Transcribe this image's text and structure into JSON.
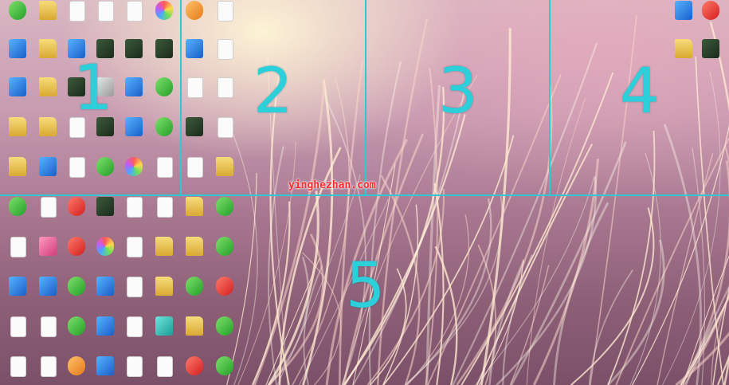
{
  "watermark": "yinghezhan.com",
  "zones": [
    {
      "label": "1"
    },
    {
      "label": "2"
    },
    {
      "label": "3"
    },
    {
      "label": "4"
    },
    {
      "label": "5"
    }
  ],
  "icons": [
    {
      "label": "",
      "kind": "app-green"
    },
    {
      "label": "",
      "kind": "folder"
    },
    {
      "label": "",
      "kind": "doc"
    },
    {
      "label": "",
      "kind": "doc"
    },
    {
      "label": "",
      "kind": "doc"
    },
    {
      "label": "",
      "kind": "app-multi"
    },
    {
      "label": "",
      "kind": "app-orange"
    },
    {
      "label": "",
      "kind": "doc"
    },
    {
      "label": "",
      "kind": "app-blue"
    },
    {
      "label": "",
      "kind": "folder"
    },
    {
      "label": "",
      "kind": "app-blue"
    },
    {
      "label": "",
      "kind": "app-dark"
    },
    {
      "label": "",
      "kind": "app-dark"
    },
    {
      "label": "",
      "kind": "app-dark"
    },
    {
      "label": "",
      "kind": "app-blue"
    },
    {
      "label": "",
      "kind": "doc"
    },
    {
      "label": "",
      "kind": "app-blue"
    },
    {
      "label": "",
      "kind": "folder"
    },
    {
      "label": "",
      "kind": "app-dark"
    },
    {
      "label": "",
      "kind": "app-gray"
    },
    {
      "label": "",
      "kind": "app-blue"
    },
    {
      "label": "",
      "kind": "app-green"
    },
    {
      "label": "",
      "kind": "doc"
    },
    {
      "label": "",
      "kind": "doc"
    },
    {
      "label": "",
      "kind": "folder"
    },
    {
      "label": "",
      "kind": "folder"
    },
    {
      "label": "",
      "kind": "doc"
    },
    {
      "label": "",
      "kind": "app-dark"
    },
    {
      "label": "",
      "kind": "app-blue"
    },
    {
      "label": "",
      "kind": "app-green"
    },
    {
      "label": "",
      "kind": "app-dark"
    },
    {
      "label": "",
      "kind": "doc"
    },
    {
      "label": "",
      "kind": "folder"
    },
    {
      "label": "",
      "kind": "app-blue"
    },
    {
      "label": "",
      "kind": "doc"
    },
    {
      "label": "",
      "kind": "app-green"
    },
    {
      "label": "",
      "kind": "app-multi"
    },
    {
      "label": "",
      "kind": "doc"
    },
    {
      "label": "",
      "kind": "doc"
    },
    {
      "label": "",
      "kind": "folder"
    },
    {
      "label": "",
      "kind": "app-green"
    },
    {
      "label": "",
      "kind": "doc"
    },
    {
      "label": "",
      "kind": "app-red"
    },
    {
      "label": "",
      "kind": "app-dark"
    },
    {
      "label": "",
      "kind": "doc"
    },
    {
      "label": "",
      "kind": "doc"
    },
    {
      "label": "",
      "kind": "folder"
    },
    {
      "label": "",
      "kind": "app-green"
    },
    {
      "label": "",
      "kind": "doc"
    },
    {
      "label": "",
      "kind": "app-pink"
    },
    {
      "label": "",
      "kind": "app-red"
    },
    {
      "label": "",
      "kind": "app-multi"
    },
    {
      "label": "",
      "kind": "doc"
    },
    {
      "label": "",
      "kind": "folder"
    },
    {
      "label": "",
      "kind": "folder"
    },
    {
      "label": "",
      "kind": "app-green"
    },
    {
      "label": "",
      "kind": "app-blue"
    },
    {
      "label": "",
      "kind": "app-blue"
    },
    {
      "label": "",
      "kind": "app-green"
    },
    {
      "label": "",
      "kind": "app-blue"
    },
    {
      "label": "",
      "kind": "doc"
    },
    {
      "label": "",
      "kind": "folder"
    },
    {
      "label": "",
      "kind": "app-green"
    },
    {
      "label": "",
      "kind": "app-red"
    },
    {
      "label": "",
      "kind": "doc"
    },
    {
      "label": "",
      "kind": "doc"
    },
    {
      "label": "",
      "kind": "app-green"
    },
    {
      "label": "",
      "kind": "app-blue"
    },
    {
      "label": "",
      "kind": "doc"
    },
    {
      "label": "",
      "kind": "app-teal"
    },
    {
      "label": "",
      "kind": "folder"
    },
    {
      "label": "",
      "kind": "app-green"
    },
    {
      "label": "",
      "kind": "doc"
    },
    {
      "label": "",
      "kind": "doc"
    },
    {
      "label": "",
      "kind": "app-orange"
    },
    {
      "label": "",
      "kind": "app-blue"
    },
    {
      "label": "",
      "kind": "doc"
    },
    {
      "label": "",
      "kind": "doc"
    },
    {
      "label": "",
      "kind": "app-red"
    },
    {
      "label": "",
      "kind": "app-green"
    },
    {
      "label": "",
      "kind": "folder"
    },
    {
      "label": "",
      "kind": "app-dark"
    }
  ]
}
